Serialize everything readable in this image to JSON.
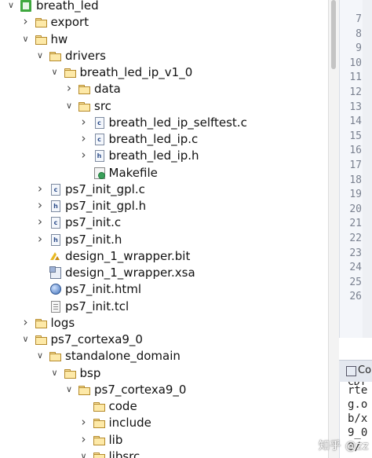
{
  "tree": [
    {
      "depth": 0,
      "label": "breath_led",
      "icon": "project-icon",
      "chevron": "expanded"
    },
    {
      "depth": 1,
      "label": "export",
      "icon": "folder-icon",
      "chevron": "collapsed"
    },
    {
      "depth": 1,
      "label": "hw",
      "icon": "folder-icon",
      "chevron": "expanded"
    },
    {
      "depth": 2,
      "label": "drivers",
      "icon": "folder-icon",
      "chevron": "expanded"
    },
    {
      "depth": 3,
      "label": "breath_led_ip_v1_0",
      "icon": "folder-icon",
      "chevron": "expanded"
    },
    {
      "depth": 4,
      "label": "data",
      "icon": "folder-icon",
      "chevron": "collapsed"
    },
    {
      "depth": 4,
      "label": "src",
      "icon": "folder-icon",
      "chevron": "expanded"
    },
    {
      "depth": 5,
      "label": "breath_led_ip_selftest.c",
      "icon": "c-file-icon",
      "chevron": "collapsed"
    },
    {
      "depth": 5,
      "label": "breath_led_ip.c",
      "icon": "c-file-icon",
      "chevron": "collapsed"
    },
    {
      "depth": 5,
      "label": "breath_led_ip.h",
      "icon": "h-file-icon",
      "chevron": "collapsed"
    },
    {
      "depth": 5,
      "label": "Makefile",
      "icon": "makefile-icon",
      "chevron": "none"
    },
    {
      "depth": 2,
      "label": "ps7_init_gpl.c",
      "icon": "c-file-icon",
      "chevron": "collapsed"
    },
    {
      "depth": 2,
      "label": "ps7_init_gpl.h",
      "icon": "h-file-icon",
      "chevron": "collapsed"
    },
    {
      "depth": 2,
      "label": "ps7_init.c",
      "icon": "c-file-icon",
      "chevron": "collapsed"
    },
    {
      "depth": 2,
      "label": "ps7_init.h",
      "icon": "h-file-icon",
      "chevron": "collapsed"
    },
    {
      "depth": 2,
      "label": "design_1_wrapper.bit",
      "icon": "bitstream-icon",
      "chevron": "none"
    },
    {
      "depth": 2,
      "label": "design_1_wrapper.xsa",
      "icon": "xsa-file-icon",
      "chevron": "none"
    },
    {
      "depth": 2,
      "label": "ps7_init.html",
      "icon": "globe-icon",
      "chevron": "none"
    },
    {
      "depth": 2,
      "label": "ps7_init.tcl",
      "icon": "tcl-file-icon",
      "chevron": "none"
    },
    {
      "depth": 1,
      "label": "logs",
      "icon": "folder-icon",
      "chevron": "collapsed"
    },
    {
      "depth": 1,
      "label": "ps7_cortexa9_0",
      "icon": "folder-icon",
      "chevron": "expanded"
    },
    {
      "depth": 2,
      "label": "standalone_domain",
      "icon": "folder-icon",
      "chevron": "expanded"
    },
    {
      "depth": 3,
      "label": "bsp",
      "icon": "folder-icon",
      "chevron": "expanded"
    },
    {
      "depth": 4,
      "label": "ps7_cortexa9_0",
      "icon": "folder-icon",
      "chevron": "expanded"
    },
    {
      "depth": 5,
      "label": "code",
      "icon": "folder-icon",
      "chevron": "none"
    },
    {
      "depth": 5,
      "label": "include",
      "icon": "folder-icon",
      "chevron": "collapsed"
    },
    {
      "depth": 5,
      "label": "lib",
      "icon": "folder-icon",
      "chevron": "collapsed"
    },
    {
      "depth": 5,
      "label": "libsrc",
      "icon": "folder-icon",
      "chevron": "expanded"
    }
  ],
  "line_numbers": [
    "7",
    "8",
    "9",
    "10",
    "11",
    "12",
    "13",
    "14",
    "15",
    "16",
    "17",
    "18",
    "19",
    "20",
    "21",
    "22",
    "23",
    "24",
    "25",
    "26"
  ],
  "console": {
    "tab_label": "Co",
    "type_label": "CDT",
    "lines": [
      "rte",
      "g.o",
      "b/x",
      "9_0",
      "0/"
    ]
  },
  "watermark": "知乎 @zz"
}
